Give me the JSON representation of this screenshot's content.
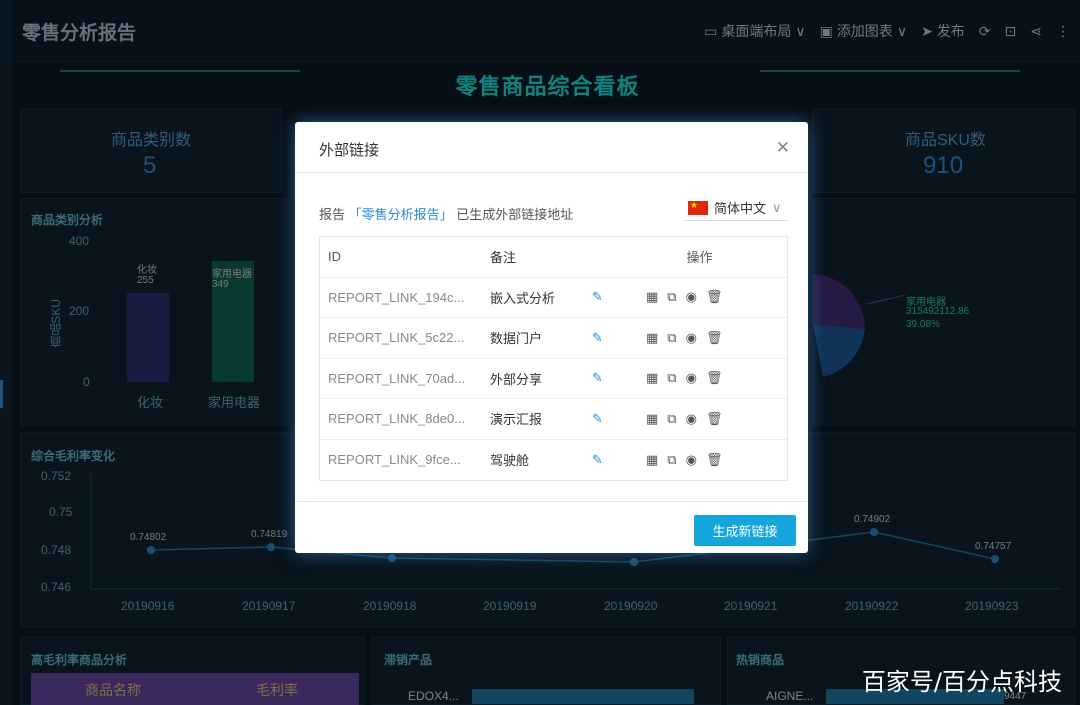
{
  "app": {
    "title": "零售分析报告"
  },
  "toolbar": {
    "layout": "桌面端布局",
    "add_chart": "添加图表",
    "publish": "发布"
  },
  "banner": {
    "title": "零售商品综合看板"
  },
  "kpis": [
    {
      "label": "商品类别数",
      "value": "5"
    },
    {
      "label": "商品SKU数",
      "value": "910"
    }
  ],
  "category_chart": {
    "title": "商品类别分析",
    "ylabel": "商品SKU",
    "yticks": [
      "400",
      "200",
      "0"
    ],
    "bars": [
      {
        "name": "化妆",
        "value": 255
      },
      {
        "name": "家用电器",
        "value": 349
      }
    ]
  },
  "pie_label": {
    "name": "家用电器",
    "value": "315492112.86",
    "pct": "39.08%"
  },
  "line_chart": {
    "title": "综合毛利率变化",
    "yticks": [
      "0.752",
      "0.75",
      "0.748",
      "0.746"
    ],
    "x": [
      "20190916",
      "20190917",
      "20190918",
      "20190919",
      "20190920",
      "20190921",
      "20190922",
      "20190923"
    ],
    "labels": [
      "0.74802",
      "0.74819",
      "",
      "",
      "",
      "",
      "0.74902",
      "0.74757"
    ]
  },
  "bottom": {
    "p1": "高毛利率商品分析",
    "p1_col1": "商品名称",
    "p1_col2": "毛利率",
    "p2": "滞销产品",
    "p2_item": "EDOX4...",
    "p3": "热销商品",
    "p3_item": "AIGNE...",
    "p3_val": "9447"
  },
  "modal": {
    "title": "外部链接",
    "info_prefix": "报告",
    "report_name": "「零售分析报告」",
    "info_suffix": "已生成外部链接地址",
    "lang": "简体中文",
    "headers": {
      "id": "ID",
      "note": "备注",
      "ops": "操作"
    },
    "rows": [
      {
        "id": "REPORT_LINK_194c...",
        "note": "嵌入式分析"
      },
      {
        "id": "REPORT_LINK_5c22...",
        "note": "数据门户"
      },
      {
        "id": "REPORT_LINK_70ad...",
        "note": "外部分享"
      },
      {
        "id": "REPORT_LINK_8de0...",
        "note": "演示汇报"
      },
      {
        "id": "REPORT_LINK_9fce...",
        "note": "驾驶舱"
      }
    ],
    "generate_label": "生成新链接"
  },
  "watermark": "百家号/百分点科技"
}
